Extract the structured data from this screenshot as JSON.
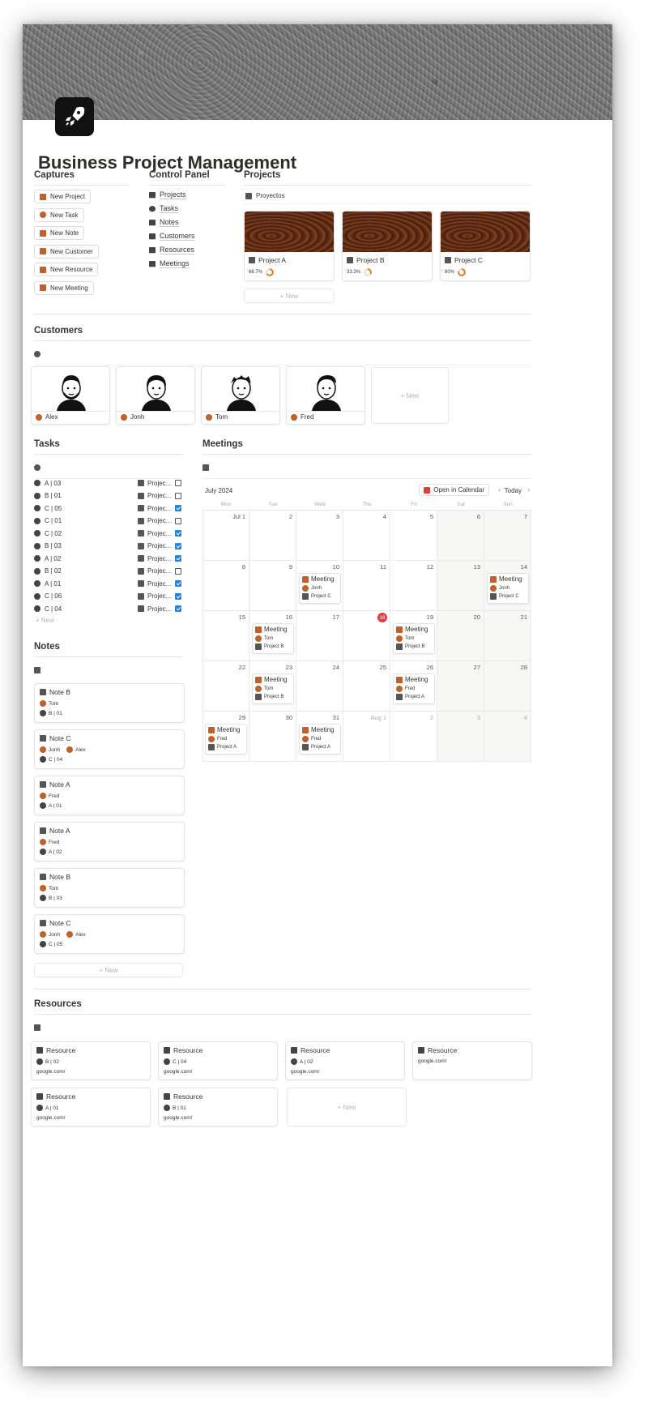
{
  "page": {
    "title": "Business Project Management"
  },
  "captures": {
    "heading": "Captures",
    "buttons": [
      {
        "label": "New Project",
        "icon": "briefcase-icon",
        "color": "#c0602c"
      },
      {
        "label": "New Task",
        "icon": "check-circle-icon",
        "color": "#c0602c"
      },
      {
        "label": "New Note",
        "icon": "note-icon",
        "color": "#c0602c"
      },
      {
        "label": "New Customer",
        "icon": "people-icon",
        "color": "#c0602c"
      },
      {
        "label": "New Resource",
        "icon": "bookmark-icon",
        "color": "#c0602c"
      },
      {
        "label": "New Meeting",
        "icon": "calendar-icon",
        "color": "#c0602c"
      }
    ]
  },
  "control_panel": {
    "heading": "Control Panel",
    "items": [
      {
        "label": "Projects",
        "icon": "briefcase-icon"
      },
      {
        "label": "Tasks",
        "icon": "check-circle-icon"
      },
      {
        "label": "Notes",
        "icon": "note-icon"
      },
      {
        "label": "Customers",
        "icon": "people-icon"
      },
      {
        "label": "Resources",
        "icon": "bookmark-icon"
      },
      {
        "label": "Meetings",
        "icon": "calendar-icon"
      }
    ]
  },
  "projects": {
    "heading": "Projects",
    "view_label": "Proyectos",
    "new_label": "+ New",
    "cards": [
      {
        "name": "Project A",
        "progress_text": "66.7%",
        "progress": 0.667
      },
      {
        "name": "Project B",
        "progress_text": "33.3%",
        "progress": 0.333
      },
      {
        "name": "Project C",
        "progress_text": "80%",
        "progress": 0.8
      }
    ]
  },
  "customers": {
    "heading": "Customers",
    "new_label": "+ New",
    "cards": [
      {
        "name": "Alex"
      },
      {
        "name": "Jonh"
      },
      {
        "name": "Tom"
      },
      {
        "name": "Fred"
      }
    ]
  },
  "tasks": {
    "heading": "Tasks",
    "new_label": "+ New",
    "rows": [
      {
        "name": "A | 03",
        "project": "Projec...",
        "done": false
      },
      {
        "name": "B | 01",
        "project": "Projec...",
        "done": false
      },
      {
        "name": "C | 05",
        "project": "Projec...",
        "done": true
      },
      {
        "name": "C | 01",
        "project": "Projec...",
        "done": false
      },
      {
        "name": "C | 02",
        "project": "Projec...",
        "done": true
      },
      {
        "name": "B | 03",
        "project": "Projec...",
        "done": true
      },
      {
        "name": "A | 02",
        "project": "Projec...",
        "done": true
      },
      {
        "name": "B | 02",
        "project": "Projec...",
        "done": false
      },
      {
        "name": "A | 01",
        "project": "Projec...",
        "done": true
      },
      {
        "name": "C | 06",
        "project": "Projec...",
        "done": true
      },
      {
        "name": "C | 04",
        "project": "Projec...",
        "done": true
      }
    ]
  },
  "meetings": {
    "heading": "Meetings",
    "month_label": "July 2024",
    "open_calendar": "Open in Calendar",
    "today": "Today",
    "weekdays": [
      "Mon",
      "Tue",
      "Wed",
      "Thu",
      "Fri",
      "Sat",
      "Sun"
    ],
    "days": [
      "Jul 1",
      "2",
      "3",
      "4",
      "5",
      "6",
      "7",
      "8",
      "9",
      "10",
      "11",
      "12",
      "13",
      "14",
      "15",
      "16",
      "17",
      "18",
      "19",
      "20",
      "21",
      "22",
      "23",
      "24",
      "25",
      "26",
      "27",
      "28",
      "29",
      "30",
      "31",
      "Aug 1",
      "2",
      "3",
      "4"
    ],
    "today_index": 17,
    "events": [
      {
        "day_index": 9,
        "title": "Meeting",
        "person": "Jonh",
        "project": "Project C"
      },
      {
        "day_index": 13,
        "title": "Meeting",
        "person": "Jonh",
        "project": "Project C"
      },
      {
        "day_index": 15,
        "title": "Meeting",
        "person": "Tom",
        "project": "Project B"
      },
      {
        "day_index": 18,
        "title": "Meeting",
        "person": "Tom",
        "project": "Project B"
      },
      {
        "day_index": 22,
        "title": "Meeting",
        "person": "Tom",
        "project": "Project B"
      },
      {
        "day_index": 25,
        "title": "Meeting",
        "person": "Fred",
        "project": "Project A"
      },
      {
        "day_index": 28,
        "title": "Meeting",
        "person": "Fred",
        "project": "Project A"
      },
      {
        "day_index": 30,
        "title": "Meeting",
        "person": "Fred",
        "project": "Project A"
      }
    ]
  },
  "notes": {
    "heading": "Notes",
    "new_label": "+ New",
    "cards": [
      {
        "title": "Note B",
        "people": [
          "Tom"
        ],
        "task": "B | 01"
      },
      {
        "title": "Note C",
        "people": [
          "Jonh",
          "Alex"
        ],
        "task": "C | 04"
      },
      {
        "title": "Note A",
        "people": [
          "Fred"
        ],
        "task": "A | 01"
      },
      {
        "title": "Note A",
        "people": [
          "Fred"
        ],
        "task": "A | 02"
      },
      {
        "title": "Note B",
        "people": [
          "Tom"
        ],
        "task": "B | 03"
      },
      {
        "title": "Note C",
        "people": [
          "Jonh",
          "Alex"
        ],
        "task": "C | 05"
      }
    ]
  },
  "resources": {
    "heading": "Resources",
    "new_label": "+ New",
    "cards": [
      {
        "title": "Resource",
        "task": "B | 02",
        "url": "google.com/"
      },
      {
        "title": "Resource",
        "task": "C | 04",
        "url": "google.com/"
      },
      {
        "title": "Resource",
        "task": "A | 02",
        "url": "google.com/"
      },
      {
        "title": "Resource",
        "task": "",
        "url": "google.com/"
      },
      {
        "title": "Resource",
        "task": "A | 01",
        "url": "google.com/"
      },
      {
        "title": "Resource",
        "task": "B | 01",
        "url": "google.com/"
      }
    ]
  },
  "colors": {
    "accent": "#c0602c",
    "today": "#e03e3e",
    "checkbox": "#2383e2"
  }
}
